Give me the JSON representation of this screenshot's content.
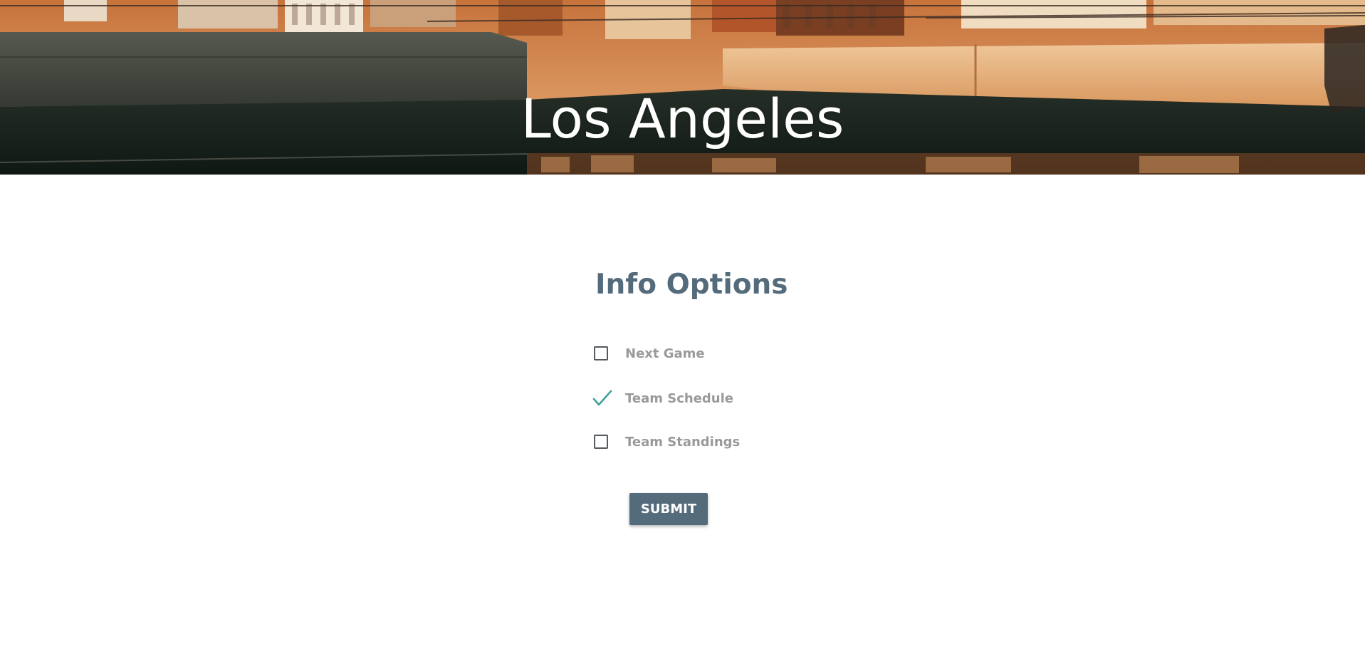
{
  "header": {
    "title": "Los Angeles"
  },
  "form": {
    "title": "Info Options",
    "options": [
      {
        "label": "Next Game",
        "checked": false
      },
      {
        "label": "Team Schedule",
        "checked": true
      },
      {
        "label": "Team Standings",
        "checked": false
      }
    ],
    "submit_label": "SUBMIT"
  },
  "colors": {
    "accent": "#546b7b",
    "check": "#3fa29a",
    "label": "#9a9a9a"
  }
}
